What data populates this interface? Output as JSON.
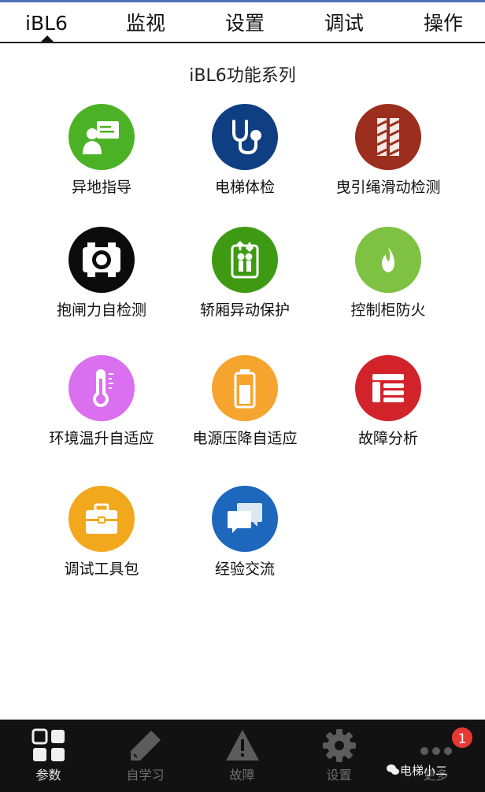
{
  "tabs": [
    {
      "label": "iBL6",
      "active": true
    },
    {
      "label": "监视"
    },
    {
      "label": "设置"
    },
    {
      "label": "调试"
    },
    {
      "label": "操作"
    }
  ],
  "section_title": "iBL6功能系列",
  "apps": [
    {
      "label": "异地指导",
      "icon": "remote-guidance-icon",
      "color": "#4cb225"
    },
    {
      "label": "电梯体检",
      "icon": "stethoscope-icon",
      "color": "#0f3f82"
    },
    {
      "label": "曳引绳滑动检测",
      "icon": "traction-rope-icon",
      "color": "#9b2e1d"
    },
    {
      "label": "抱闸力自检测",
      "icon": "brake-icon",
      "color": "#0b0b0b"
    },
    {
      "label": "轿厢异动保护",
      "icon": "elevator-car-icon",
      "color": "#3e9a12"
    },
    {
      "label": "控制柜防火",
      "icon": "fire-icon",
      "color": "#7fc243"
    },
    {
      "label": "环境温升自适应",
      "icon": "thermometer-icon",
      "color": "#da6ff0"
    },
    {
      "label": "电源压降自适应",
      "icon": "battery-icon",
      "color": "#f5a52e"
    },
    {
      "label": "故障分析",
      "icon": "fault-list-icon",
      "color": "#d2232a"
    },
    {
      "label": "调试工具包",
      "icon": "toolbox-icon",
      "color": "#f2a81d"
    },
    {
      "label": "经验交流",
      "icon": "chat-icon",
      "color": "#1d67bd"
    }
  ],
  "bottom_nav": [
    {
      "label": "参数",
      "icon": "grid-icon",
      "active": true
    },
    {
      "label": "自学习",
      "icon": "pencil-icon"
    },
    {
      "label": "故障",
      "icon": "warning-icon"
    },
    {
      "label": "设置",
      "icon": "gear-icon"
    },
    {
      "label": "更多",
      "icon": "more-icon",
      "badge": "1"
    }
  ],
  "watermark": "电梯小二"
}
